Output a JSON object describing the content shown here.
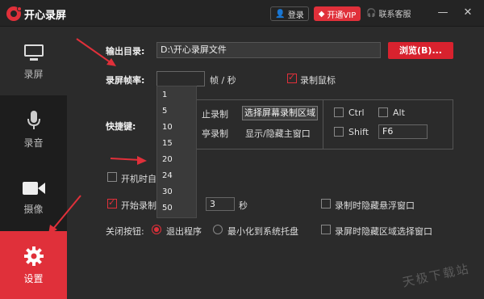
{
  "app": {
    "title": "开心录屏"
  },
  "header": {
    "login": "登录",
    "vip": "开通VIP",
    "support": "联系客服",
    "minimize": "—",
    "close": "✕"
  },
  "sidebar": {
    "items": [
      {
        "label": "录屏"
      },
      {
        "label": "录音"
      },
      {
        "label": "摄像"
      },
      {
        "label": "设置"
      }
    ]
  },
  "settings": {
    "output_dir_label": "输出目录:",
    "output_dir_value": "D:\\开心录屏文件",
    "browse_label": "浏览(B)...",
    "fps_label": "录屏帧率:",
    "fps_unit": "帧 / 秒",
    "record_mouse_label": "录制鼠标",
    "fps_options": [
      "1",
      "5",
      "10",
      "15",
      "20",
      "24",
      "30",
      "50"
    ],
    "hotkey_label": "快捷键:",
    "hotkey_start_partial": "止录制",
    "hotkey_select_region": "选择屏幕录制区域",
    "hotkey_pause_partial": "亭录制",
    "hotkey_toggle_window": "显示/隐藏主窗口",
    "ctrl_label": "Ctrl",
    "alt_label": "Alt",
    "shift_label": "Shift",
    "key_value": "F6",
    "autostart_label": "开机时自",
    "start_record_label": "开始录制",
    "start_delay_value": "3",
    "seconds_unit": "秒",
    "hide_float_label": "录制时隐藏悬浮窗口",
    "close_btn_label": "关闭按钮:",
    "exit_option": "退出程序",
    "minimize_option": "最小化到系统托盘",
    "hide_region_label": "录屏时隐藏区域选择窗口"
  },
  "watermark": "天极下载站"
}
